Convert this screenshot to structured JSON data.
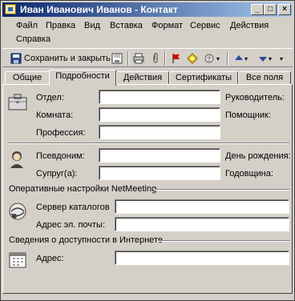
{
  "window": {
    "title": "Иван Иванович Иванов - Контакт"
  },
  "titlebar_buttons": {
    "minimize": "_",
    "maximize": "□",
    "close": "×"
  },
  "menu": [
    "Файл",
    "Правка",
    "Вид",
    "Вставка",
    "Формат",
    "Сервис",
    "Действия",
    "Справка"
  ],
  "toolbar": {
    "save_close": "Сохранить и закрыть"
  },
  "tabs": [
    "Общие",
    "Подробности",
    "Действия",
    "Сертификаты",
    "Все поля"
  ],
  "active_tab": "Подробности",
  "details": {
    "labels": {
      "department": "Отдел:",
      "office": "Комната:",
      "profession": "Профессия:",
      "manager": "Руководитель:",
      "assistant": "Помощник:",
      "nickname": "Псевдоним:",
      "spouse": "Супруг(а):",
      "birthday": "День рождения:",
      "anniversary": "Годовщина:",
      "directory_server": "Сервер каталогов",
      "email_alias": "Адрес эл. почты:",
      "address": "Адрес:"
    },
    "values": {
      "department": "",
      "office": "",
      "profession": "",
      "manager": "",
      "assistant": "",
      "nickname": "",
      "spouse": "",
      "birthday": "",
      "anniversary": "",
      "directory_server": "",
      "email_alias": "",
      "address": ""
    },
    "groups": {
      "netmeeting": "Оперативные настройки NetMeeting",
      "freebusy": "Сведения о доступности в Интернете"
    }
  },
  "icons": [
    "briefcase-icon",
    "person-icon",
    "netmeeting-icon",
    "calendar-icon",
    "save-icon",
    "print-icon",
    "attach-icon",
    "flag-icon",
    "categories-icon",
    "up-arrow-icon",
    "down-arrow-icon"
  ]
}
